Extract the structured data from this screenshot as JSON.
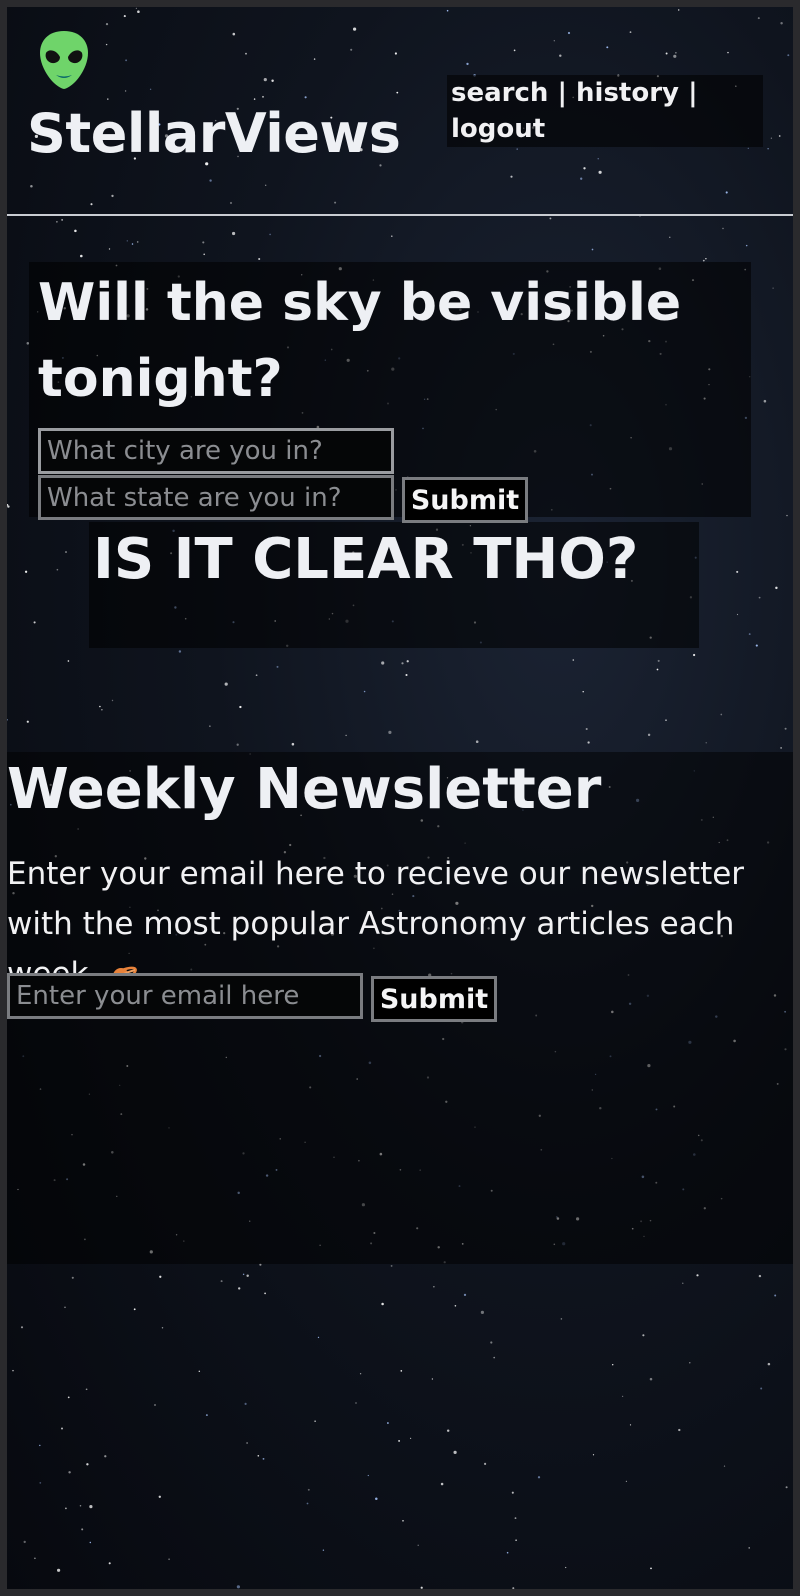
{
  "header": {
    "logo_icon": "alien-face-icon",
    "brand": "StellarViews",
    "nav": {
      "search": "search",
      "separator": "|",
      "history": "history",
      "logout": "logout"
    }
  },
  "visibility": {
    "question": "Will the sky be visible tonight?",
    "city_placeholder": "What city are you in?",
    "state_placeholder": "What state are you in?",
    "submit_label": "Submit",
    "answer": "IS IT CLEAR THO?"
  },
  "newsletter": {
    "title": "Weekly Newsletter",
    "description": "Enter your email here to recieve our newsletter with the most popular Astronomy articles each week.",
    "planet_icon": "ringed-planet-icon",
    "email_placeholder": "Enter your email here",
    "submit_label": "Submit"
  },
  "colors": {
    "alien_green": "#6fd46a",
    "planet_orange": "#e8823a",
    "background": "#0b0f18",
    "text": "#f1f1f3"
  }
}
